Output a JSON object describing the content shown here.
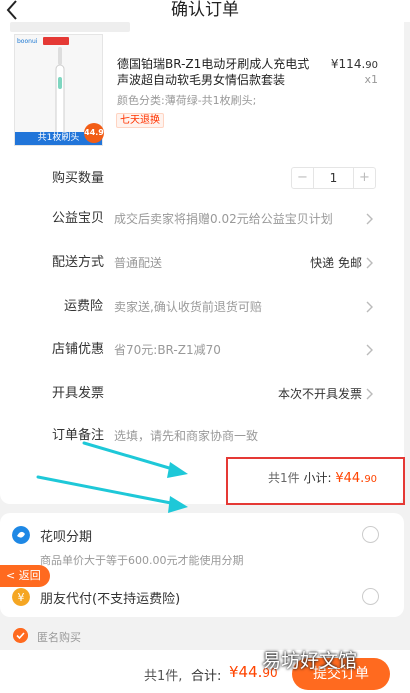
{
  "nav": {
    "title": "确认订单"
  },
  "product": {
    "title": "德国铂瑞BR-Z1电动牙刷成人充电式声波超自动软毛男女情侣款套装",
    "price_symbol": "¥",
    "price_int": "114.",
    "price_dec": "90",
    "quantity": "x1",
    "variant": "颜色分类:薄荷绿-共1枚刷头;",
    "return_tag": "七天退换",
    "image_brand": "boonui",
    "image_band_text": "共1枚刷头",
    "image_price": "44.9"
  },
  "rows": {
    "quantity_label": "购买数量",
    "quantity_value": "1",
    "quantity_minus": "−",
    "quantity_plus": "+",
    "charity_label": "公益宝贝",
    "charity_value": "成交后卖家将捐赠0.02元给公益宝贝计划",
    "shipping_label": "配送方式",
    "shipping_value": "普通配送",
    "shipping_right": "快递 免邮",
    "insurance_label": "运费险",
    "insurance_value": "卖家送,确认收货前退货可赔",
    "discount_label": "店铺优惠",
    "discount_value": "省70元:BR-Z1减70",
    "invoice_label": "开具发票",
    "invoice_right": "本次不开具发票",
    "remark_label": "订单备注",
    "remark_placeholder": "选填，请先和商家协商一致"
  },
  "subtotal": {
    "count": "共1件",
    "label": "小计:",
    "symbol": "¥",
    "int": "44.",
    "dec": "90"
  },
  "payment": {
    "huabei_label": "花呗分期",
    "huabei_sub": "商品单价大于等于600.00元才能使用分期",
    "friend_label": "朋友代付(不支持运费险)"
  },
  "return_pill": "< 返回",
  "anonymous": {
    "label": "匿名购买"
  },
  "bottom": {
    "count": "共1件,",
    "total_label": "合计:",
    "symbol": "¥",
    "int": "44.",
    "dec": "90",
    "submit": "提交订单"
  },
  "watermark": "易坊好文馆",
  "colors": {
    "accent": "#ff6a1f",
    "price": "#ff4400",
    "highlight_box": "#e53935",
    "annotation_arrow": "#1ec8d8",
    "image_band": "#2175d9"
  }
}
